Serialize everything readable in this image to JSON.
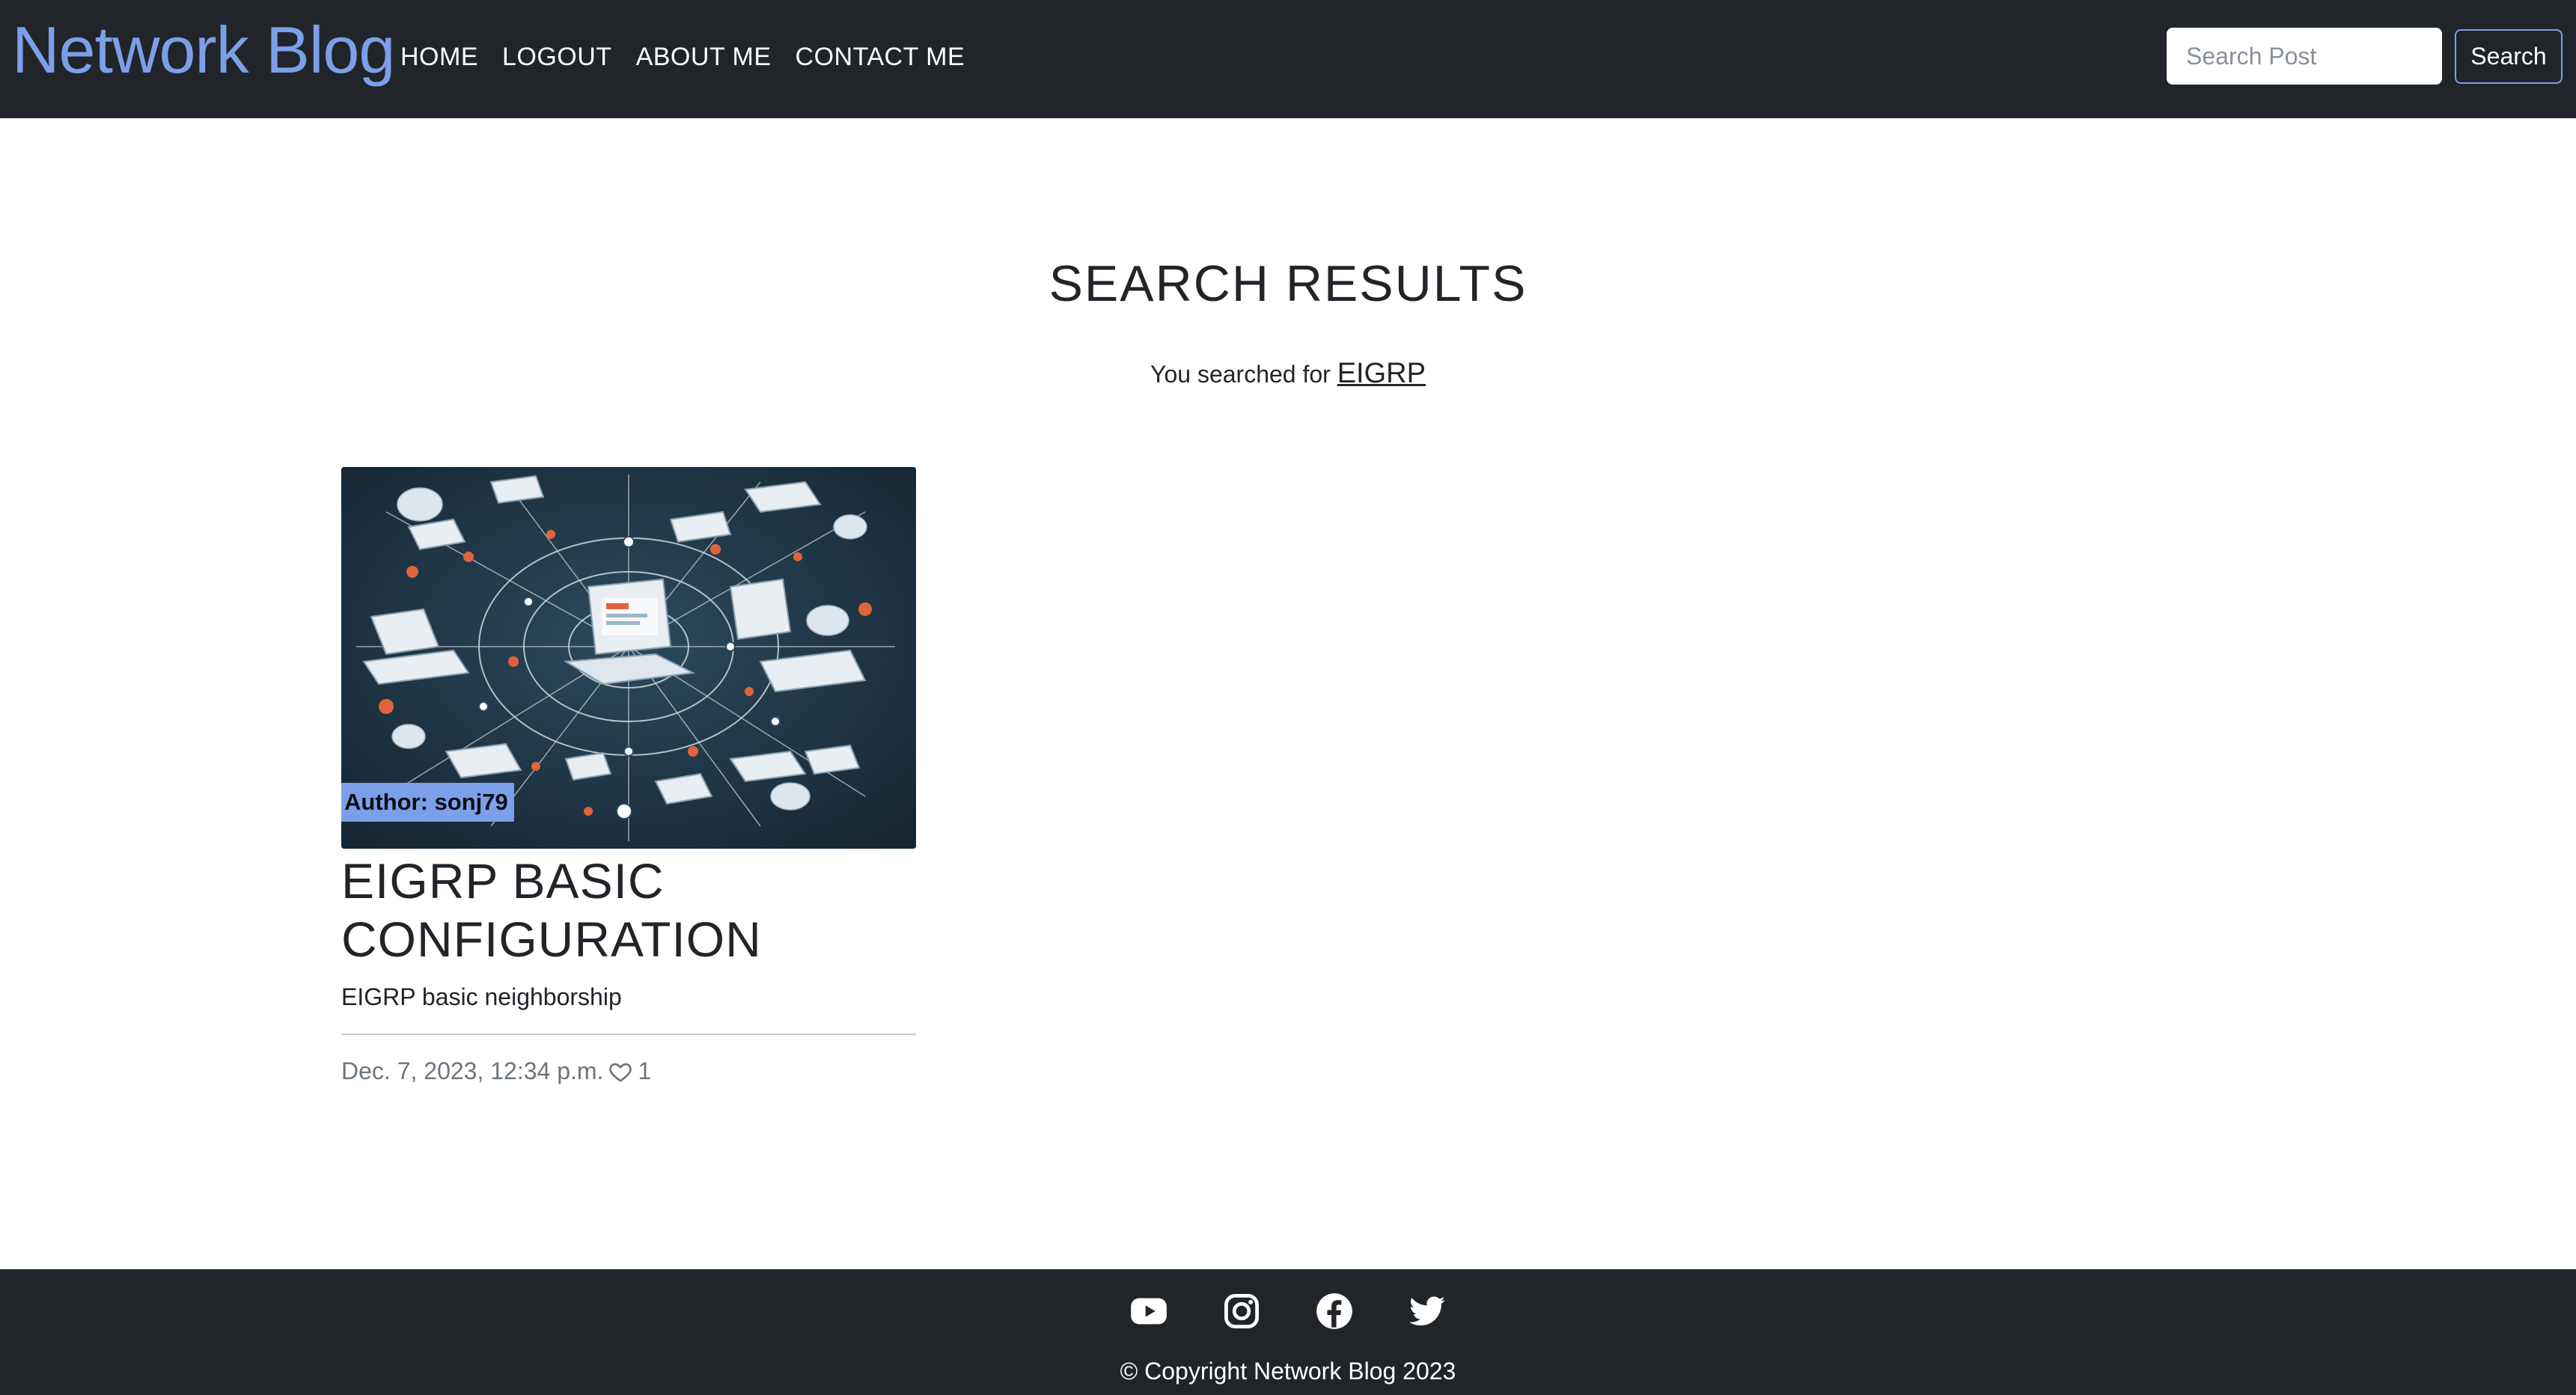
{
  "navbar": {
    "brand": "Network Blog",
    "links": [
      "HOME",
      "LOGOUT",
      "ABOUT ME",
      "CONTACT ME"
    ],
    "search_placeholder": "Search Post",
    "search_button": "Search"
  },
  "main": {
    "title": "SEARCH RESULTS",
    "searched_prefix": "You searched for",
    "search_term": "EIGRP"
  },
  "post": {
    "author_label": "Author: sonj79",
    "title": "EIGRP BASIC CONFIGURATION",
    "excerpt": "EIGRP basic neighborship",
    "date": "Dec. 7, 2023, 12:34 p.m.",
    "likes": "1",
    "image_icon": "network-illustration"
  },
  "footer": {
    "icons": [
      "youtube-icon",
      "instagram-icon",
      "facebook-icon",
      "twitter-icon"
    ],
    "copyright": "© Copyright Network Blog 2023"
  },
  "colors": {
    "navbar_bg": "#212529",
    "accent": "#7b9fe8",
    "footer_bg": "#212529"
  }
}
